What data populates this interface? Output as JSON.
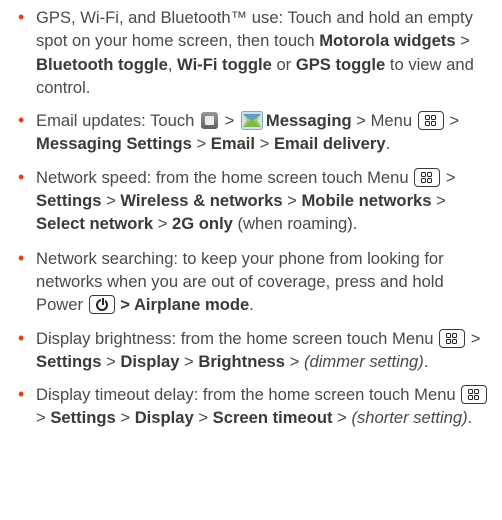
{
  "icons": {
    "bullet": "orange-bullet-dot",
    "menu_key": "menu-key-icon",
    "power_key": "power-key-icon",
    "launcher": "app-launcher-icon",
    "messaging": "messaging-app-icon"
  },
  "colors": {
    "bullet": "#e8411e",
    "body_text": "#4a4a4a",
    "bold_text": "#3a3a3a"
  },
  "tips": [
    {
      "lead": "GPS, Wi-Fi, and Bluetooth™ use: Touch and hold an empty spot on your home screen, then touch ",
      "b1": "Motorola widgets",
      "sep1": " > ",
      "b2": "Bluetooth toggle",
      "sep2": ", ",
      "b3": "Wi-Fi toggle",
      "sep3": " or ",
      "b4": "GPS toggle",
      "tail": " to view and control."
    },
    {
      "lead": "Email updates: Touch ",
      "sep1": " > ",
      "b1": "Messaging",
      "sep2": " > ",
      "menu": "Menu",
      "sep3": " > ",
      "b2": "Messaging Settings",
      "sep4": " > ",
      "b3": "Email",
      "sep5": " > ",
      "b4": "Email delivery",
      "tail": "."
    },
    {
      "lead": "Network speed: from the home screen touch Menu ",
      "sep1": " > ",
      "b1": "Settings",
      "sep2": " > ",
      "b2": "Wireless & networks",
      "sep3": " > ",
      "b3": "Mobile networks",
      "sep4": " > ",
      "b4": "Select network",
      "sep5": " > ",
      "b5": "2G only",
      "tail": " (when roaming)."
    },
    {
      "lead": "Network searching: to keep your phone from looking for networks when you are out of coverage, press and hold Power ",
      "b1": " > Airplane mode",
      "tail": "."
    },
    {
      "lead": "Display brightness: from the home screen touch Menu ",
      "sep1": " > ",
      "b1": "Settings",
      "sep2": " > ",
      "b2": "Display",
      "sep3": " > ",
      "b3": "Brightness",
      "sep4": " > ",
      "i1": "(dimmer setting)",
      "tail": "."
    },
    {
      "lead": "Display timeout delay: from the home screen touch Menu ",
      "sep1": " > ",
      "b1": "Settings",
      "sep2": " > ",
      "b2": "Display",
      "sep3": " > ",
      "b3": "Screen timeout",
      "sep4": " > ",
      "i1": "(shorter setting)",
      "tail": "."
    }
  ]
}
